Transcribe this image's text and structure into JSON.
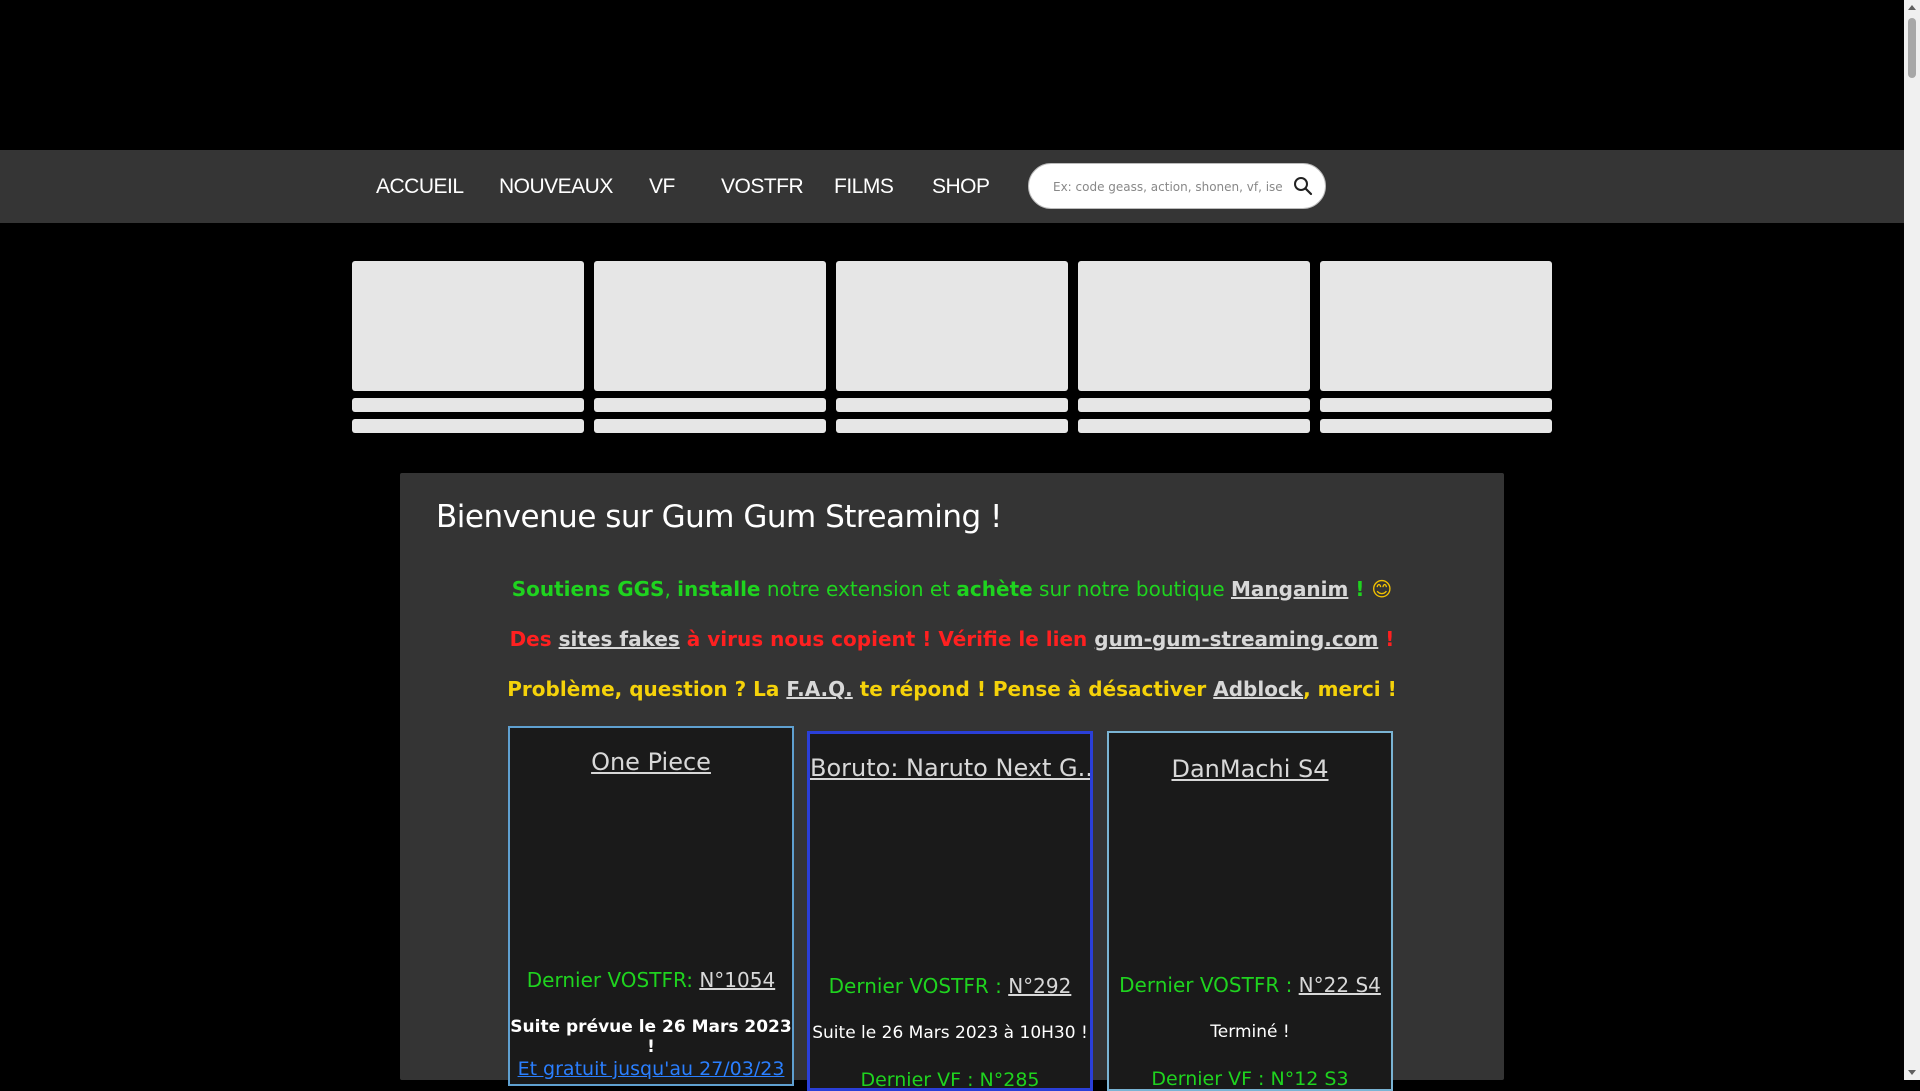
{
  "nav": {
    "items": [
      "ACCUEIL",
      "NOUVEAUX",
      "VF",
      "VOSTFR",
      "FILMS",
      "SHOP"
    ]
  },
  "search": {
    "placeholder": "Ex: code geass, action, shonen, vf, isekai..."
  },
  "welcome": {
    "title": "Bienvenue sur Gum Gum Streaming !",
    "line1": {
      "a": "Soutiens GGS",
      "b": ", ",
      "c": "installe",
      "d": " notre extension et ",
      "e": "achète",
      "f": " sur notre boutique ",
      "link": "Manganim",
      "g": " ! ",
      "emoji": "😊"
    },
    "line2": {
      "a": "Des ",
      "link1": "sites fakes",
      "b": " à virus nous copient ! Vérifie le lien ",
      "link2": "gum-gum-streaming.com",
      "c": " !"
    },
    "line3": {
      "a": "Problème, question ? La ",
      "link1": "F.A.Q.",
      "b": " te répond ! Pense à désactiver ",
      "link2": "Adblock",
      "c": ", merci !"
    }
  },
  "cards": [
    {
      "title": "One Piece",
      "latest_label": "Dernier VOSTFR: ",
      "latest_link": "N°1054",
      "next": "Suite prévue le 26 Mars 2023 !",
      "extra": "Et gratuit jusqu'au 27/03/23",
      "border": "#5fa0d0"
    },
    {
      "title": "Boruto: Naruto Next G..",
      "latest_label": "Dernier VOSTFR : ",
      "latest_link": "N°292",
      "next": "Suite le 26 Mars 2023 à 10H30 !",
      "extra": "Dernier VF : N°285",
      "border": "#2a3fd8"
    },
    {
      "title": "DanMachi S4",
      "latest_label": "Dernier VOSTFR : ",
      "latest_link": "N°22 S4",
      "next": "Terminé !",
      "extra": "Dernier VF : N°12 S3",
      "border": "#7ab4d4"
    }
  ]
}
